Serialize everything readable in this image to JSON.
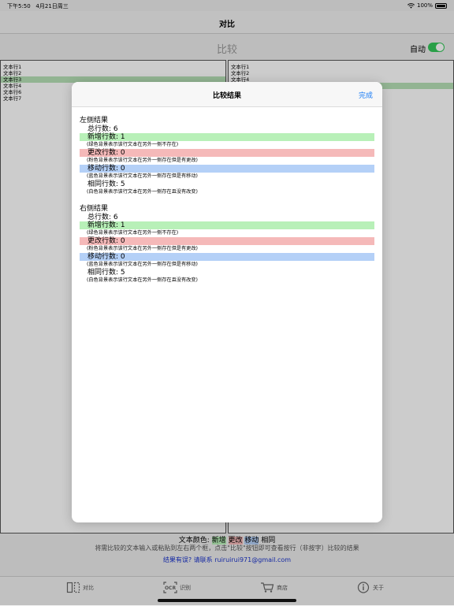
{
  "status": {
    "time": "下午5:50",
    "date": "4月21日周三",
    "battery": "100%"
  },
  "nav": {
    "title": "对比"
  },
  "compare": {
    "title": "比较",
    "auto_label": "自动",
    "auto_on": true
  },
  "left_pane": {
    "lines": [
      "文本行1",
      "文本行2",
      "文本行3",
      "文本行4",
      "文本行6",
      "文本行7"
    ]
  },
  "right_pane": {
    "lines": [
      "文本行1",
      "文本行2",
      "文本行4"
    ]
  },
  "legend": {
    "prefix": "文本颜色: ",
    "new": "新增",
    "changed": "更改",
    "moved": "移动",
    "same": "相同"
  },
  "hint": "将需比较的文本输入或粘贴到左右两个框，点击\"比较\"按钮即可查看按行（非按字）比较的结果",
  "contact": "结果有误? 请联系 ruiruirui971@gmail.com",
  "tabs": [
    {
      "label": "对比",
      "icon": "compare-icon"
    },
    {
      "label": "识别",
      "icon": "ocr-icon"
    },
    {
      "label": "商店",
      "icon": "cart-icon"
    },
    {
      "label": "关于",
      "icon": "info-icon"
    }
  ],
  "modal": {
    "title": "比较结果",
    "done": "完成",
    "left": {
      "title": "左侧结果",
      "total": "总行数: 6",
      "added": "新增行数: 1",
      "added_note": "(绿色背景表示该行文本在另外一侧不存在)",
      "changed": "更改行数: 0",
      "changed_note": "(粉色背景表示该行文本在另外一侧存在但是有更改)",
      "moved": "移动行数: 0",
      "moved_note": "(蓝色背景表示该行文本在另外一侧存在但是有移动)",
      "same": "相同行数: 5",
      "same_note": "(白色背景表示该行文本在另外一侧存在且没有改变)"
    },
    "right": {
      "title": "右侧结果",
      "total": "总行数: 6",
      "added": "新增行数: 1",
      "added_note": "(绿色背景表示该行文本在另外一侧不存在)",
      "changed": "更改行数: 0",
      "changed_note": "(粉色背景表示该行文本在另外一侧存在但是有更改)",
      "moved": "移动行数: 0",
      "moved_note": "(蓝色背景表示该行文本在另外一侧存在但是有移动)",
      "same": "相同行数: 5",
      "same_note": "(白色背景表示该行文本在另外一侧存在且没有改变)"
    }
  }
}
